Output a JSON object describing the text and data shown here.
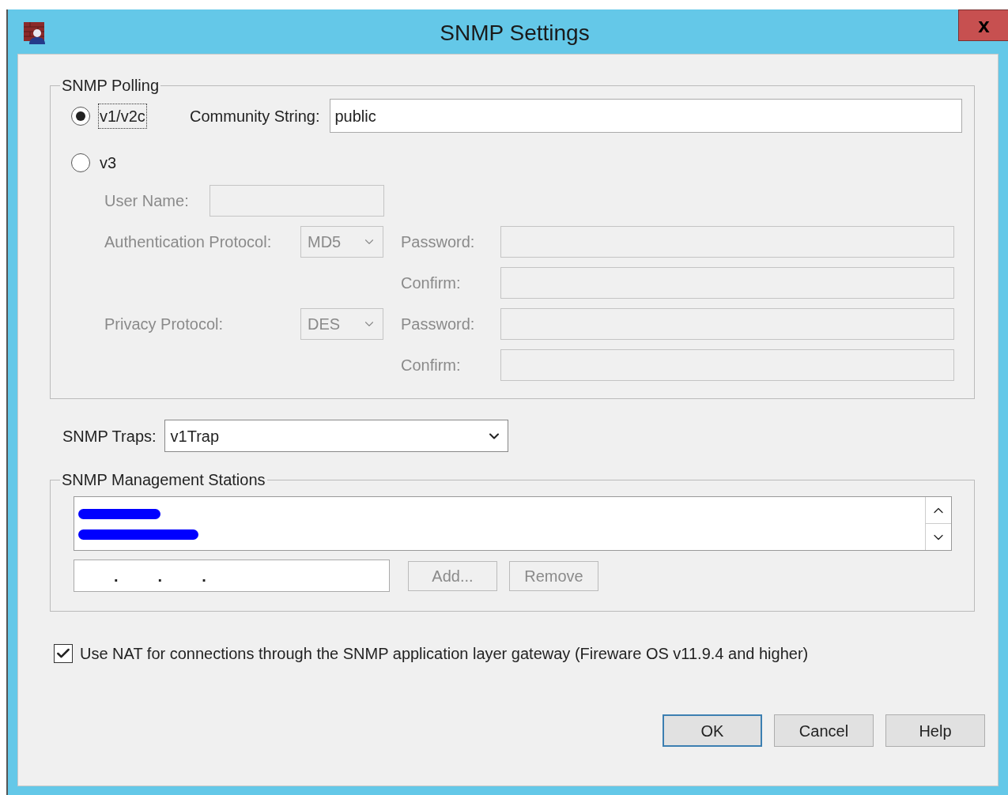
{
  "window": {
    "title": "SNMP Settings",
    "close": "x"
  },
  "polling": {
    "legend": "SNMP Polling",
    "versions": [
      {
        "label": "v1/v2c",
        "selected": true,
        "focused": true
      },
      {
        "label": "v3",
        "selected": false,
        "focused": false
      }
    ],
    "community": {
      "label": "Community String:",
      "value": "public"
    },
    "v3": {
      "disabled": true,
      "user_name": {
        "label": "User Name:"
      },
      "auth": {
        "label": "Authentication Protocol:",
        "value": "MD5",
        "password": "Password:",
        "confirm": "Confirm:"
      },
      "privacy": {
        "label": "Privacy Protocol:",
        "value": "DES",
        "password": "Password:",
        "confirm": "Confirm:"
      }
    }
  },
  "traps": {
    "label": "SNMP Traps:",
    "value": "v1Trap"
  },
  "stations": {
    "legend": "SNMP Management Stations",
    "items": [
      {
        "kind": "redacted"
      },
      {
        "kind": "redacted"
      }
    ],
    "address_separators": [
      ".",
      ".",
      "."
    ],
    "buttons": [
      {
        "label": "Add...",
        "disabled": true
      },
      {
        "label": "Remove",
        "disabled": true
      }
    ]
  },
  "nat": {
    "label": "Use NAT for connections through the SNMP application layer gateway (Fireware OS v11.9.4 and higher)",
    "checked": true
  },
  "buttons": [
    {
      "label": "OK",
      "default": true
    },
    {
      "label": "Cancel",
      "default": false
    },
    {
      "label": "Help",
      "default": false
    }
  ]
}
